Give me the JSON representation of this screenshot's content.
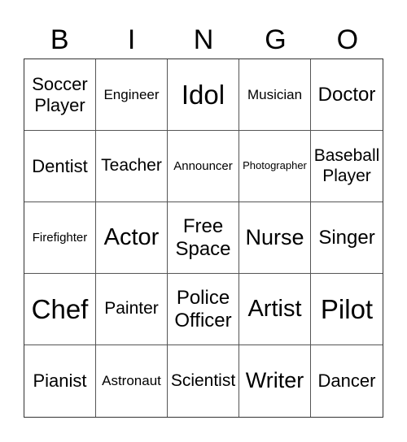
{
  "header": [
    "B",
    "I",
    "N",
    "G",
    "O"
  ],
  "cells": [
    "Soccer Player",
    "Engineer",
    "Idol",
    "Musician",
    "Doctor",
    "Dentist",
    "Teacher",
    "Announcer",
    "Photographer",
    "Baseball Player",
    "Firefighter",
    "Actor",
    "Free Space",
    "Nurse",
    "Singer",
    "Chef",
    "Painter",
    "Police Officer",
    "Artist",
    "Pilot",
    "Pianist",
    "Astronaut",
    "Scientist",
    "Writer",
    "Dancer"
  ]
}
